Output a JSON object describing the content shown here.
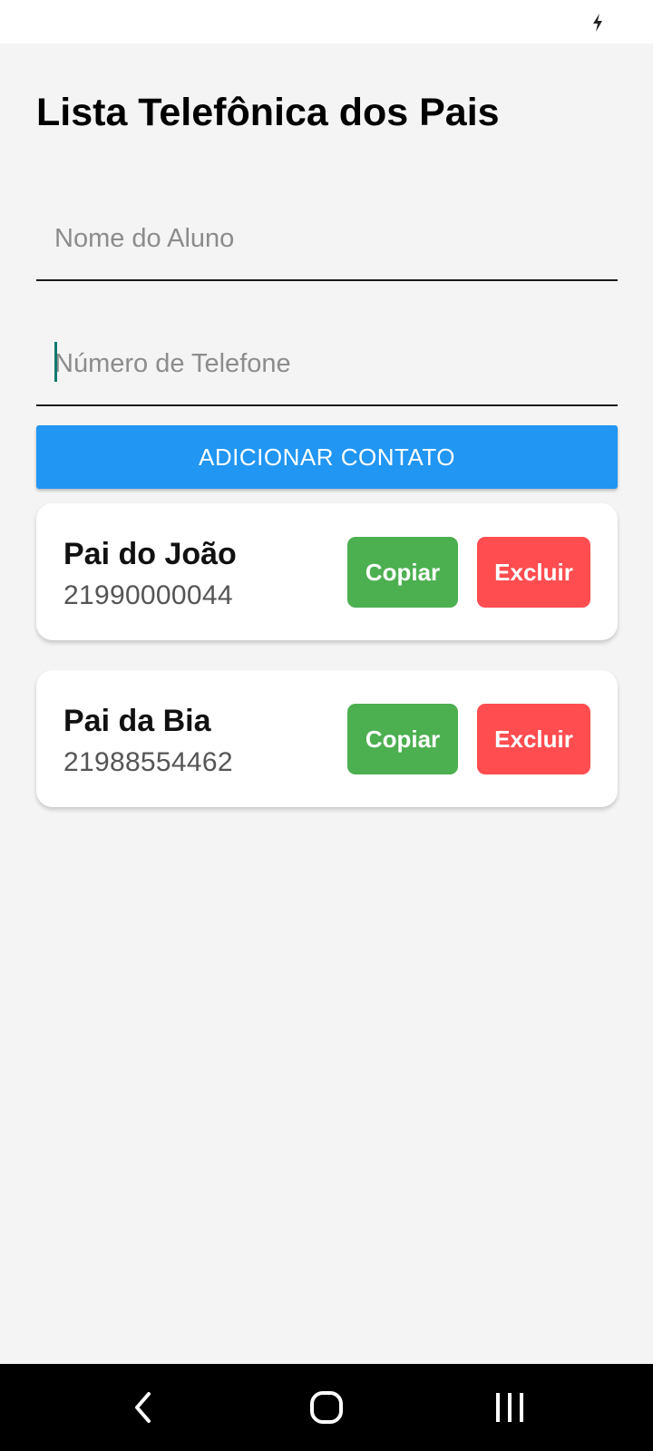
{
  "status_bar": {
    "icons": [
      "charging-icon"
    ]
  },
  "header": {
    "title": "Lista Telefônica dos Pais"
  },
  "form": {
    "name_field": {
      "value": "",
      "placeholder": "Nome do Aluno"
    },
    "phone_field": {
      "value": "",
      "placeholder": "Número de Telefone"
    },
    "add_button_label": "ADICIONAR CONTATO"
  },
  "contacts": [
    {
      "name": "Pai do João",
      "phone": "21990000044",
      "copy_label": "Copiar",
      "delete_label": "Excluir"
    },
    {
      "name": "Pai da Bia",
      "phone": "21988554462",
      "copy_label": "Copiar",
      "delete_label": "Excluir"
    }
  ],
  "navigation_bar": {
    "buttons": [
      "back-icon",
      "home-icon",
      "recent-apps-icon"
    ]
  },
  "colors": {
    "background": "#f4f4f4",
    "primary": "#2196f3",
    "copy": "#4caf50",
    "delete": "#ff4d50",
    "caret": "#0e7a6f"
  }
}
